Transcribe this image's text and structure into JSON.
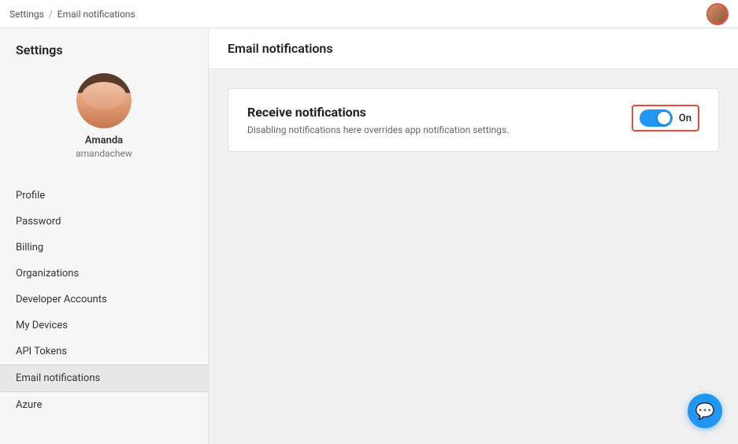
{
  "topbar": {
    "breadcrumb_settings": "Settings",
    "breadcrumb_sep": "/",
    "breadcrumb_current": "Email notifications"
  },
  "sidebar": {
    "title": "Settings",
    "user": {
      "name": "Amanda",
      "handle": "amandachew"
    },
    "nav_items": [
      {
        "id": "profile",
        "label": "Profile",
        "active": false
      },
      {
        "id": "password",
        "label": "Password",
        "active": false
      },
      {
        "id": "billing",
        "label": "Billing",
        "active": false
      },
      {
        "id": "organizations",
        "label": "Organizations",
        "active": false
      },
      {
        "id": "developer-accounts",
        "label": "Developer Accounts",
        "active": false
      },
      {
        "id": "my-devices",
        "label": "My Devices",
        "active": false
      },
      {
        "id": "api-tokens",
        "label": "API Tokens",
        "active": false
      },
      {
        "id": "email-notifications",
        "label": "Email notifications",
        "active": true
      },
      {
        "id": "azure",
        "label": "Azure",
        "active": false
      }
    ]
  },
  "main": {
    "header": "Email notifications",
    "card": {
      "title": "Receive notifications",
      "description": "Disabling notifications here overrides app notification settings.",
      "toggle_state": "On",
      "toggle_on": true
    }
  }
}
